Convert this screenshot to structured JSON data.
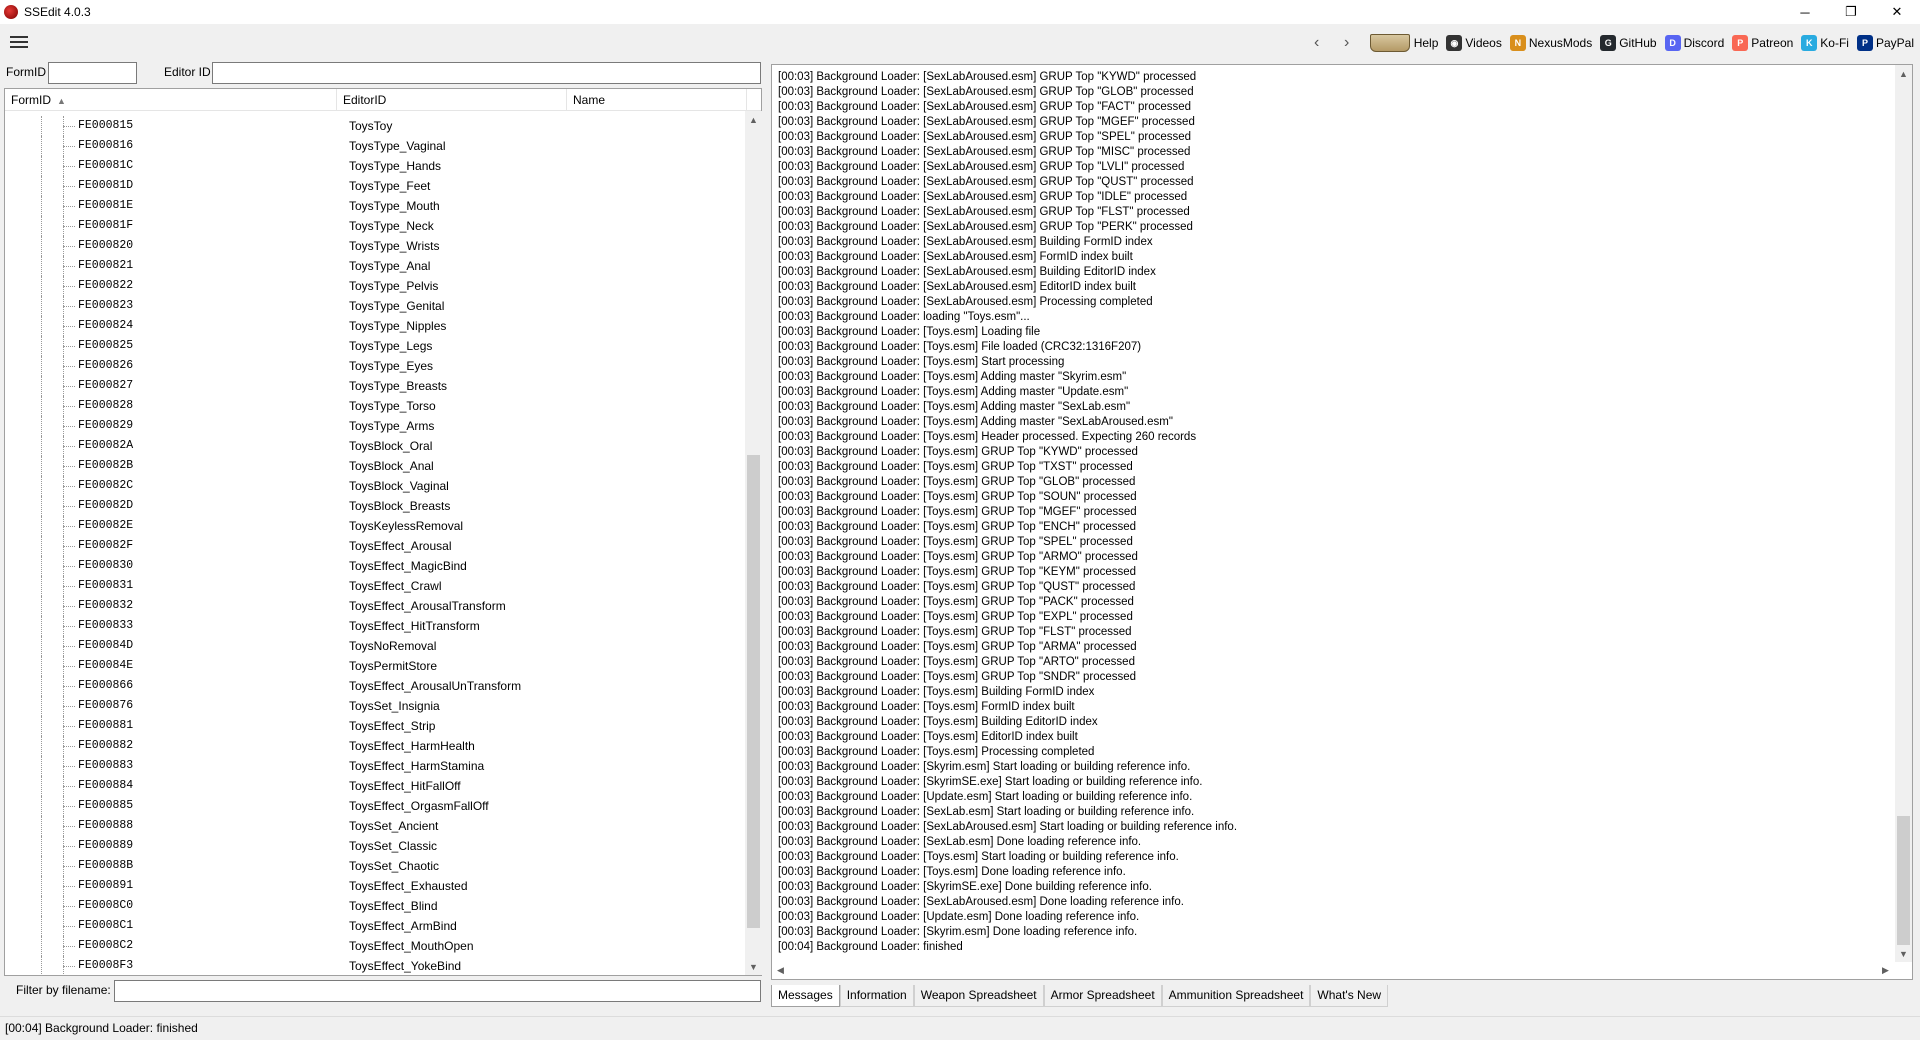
{
  "window": {
    "title": "SSEdit 4.0.3",
    "minimize": "─",
    "maximize": "❐",
    "close": "✕"
  },
  "toolbar": {
    "back": "‹",
    "forward": "›",
    "links": [
      {
        "id": "help",
        "label": "Help",
        "icon": "book-icon",
        "color": "#b49a66"
      },
      {
        "id": "videos",
        "label": "Videos",
        "icon": "videos-icon",
        "color": "#333333",
        "glyph": "◉"
      },
      {
        "id": "nexusmods",
        "label": "NexusMods",
        "icon": "nexusmods-icon",
        "color": "#d98f1c",
        "glyph": "N"
      },
      {
        "id": "github",
        "label": "GitHub",
        "icon": "github-icon",
        "color": "#24292e",
        "glyph": "G"
      },
      {
        "id": "discord",
        "label": "Discord",
        "icon": "discord-icon",
        "color": "#5865f2",
        "glyph": "D"
      },
      {
        "id": "patreon",
        "label": "Patreon",
        "icon": "patreon-icon",
        "color": "#f96854",
        "glyph": "P"
      },
      {
        "id": "kofi",
        "label": "Ko-Fi",
        "icon": "kofi-icon",
        "color": "#29abe0",
        "glyph": "K"
      },
      {
        "id": "paypal",
        "label": "PayPal",
        "icon": "paypal-icon",
        "color": "#003087",
        "glyph": "P"
      }
    ]
  },
  "filter": {
    "formid_label": "FormID",
    "formid_value": "",
    "editorid_label": "Editor ID",
    "editorid_value": ""
  },
  "tree": {
    "columns": {
      "formid": "FormID",
      "editorid": "EditorID",
      "name": "Name"
    },
    "rows": [
      {
        "formid": "FE000815",
        "editorid": "ToysToy"
      },
      {
        "formid": "FE000816",
        "editorid": "ToysType_Vaginal"
      },
      {
        "formid": "FE00081C",
        "editorid": "ToysType_Hands"
      },
      {
        "formid": "FE00081D",
        "editorid": "ToysType_Feet"
      },
      {
        "formid": "FE00081E",
        "editorid": "ToysType_Mouth"
      },
      {
        "formid": "FE00081F",
        "editorid": "ToysType_Neck"
      },
      {
        "formid": "FE000820",
        "editorid": "ToysType_Wrists"
      },
      {
        "formid": "FE000821",
        "editorid": "ToysType_Anal"
      },
      {
        "formid": "FE000822",
        "editorid": "ToysType_Pelvis"
      },
      {
        "formid": "FE000823",
        "editorid": "ToysType_Genital"
      },
      {
        "formid": "FE000824",
        "editorid": "ToysType_Nipples"
      },
      {
        "formid": "FE000825",
        "editorid": "ToysType_Legs"
      },
      {
        "formid": "FE000826",
        "editorid": "ToysType_Eyes"
      },
      {
        "formid": "FE000827",
        "editorid": "ToysType_Breasts"
      },
      {
        "formid": "FE000828",
        "editorid": "ToysType_Torso"
      },
      {
        "formid": "FE000829",
        "editorid": "ToysType_Arms"
      },
      {
        "formid": "FE00082A",
        "editorid": "ToysBlock_Oral"
      },
      {
        "formid": "FE00082B",
        "editorid": "ToysBlock_Anal"
      },
      {
        "formid": "FE00082C",
        "editorid": "ToysBlock_Vaginal"
      },
      {
        "formid": "FE00082D",
        "editorid": "ToysBlock_Breasts"
      },
      {
        "formid": "FE00082E",
        "editorid": "ToysKeylessRemoval"
      },
      {
        "formid": "FE00082F",
        "editorid": "ToysEffect_Arousal"
      },
      {
        "formid": "FE000830",
        "editorid": "ToysEffect_MagicBind"
      },
      {
        "formid": "FE000831",
        "editorid": "ToysEffect_Crawl"
      },
      {
        "formid": "FE000832",
        "editorid": "ToysEffect_ArousalTransform"
      },
      {
        "formid": "FE000833",
        "editorid": "ToysEffect_HitTransform"
      },
      {
        "formid": "FE00084D",
        "editorid": "ToysNoRemoval"
      },
      {
        "formid": "FE00084E",
        "editorid": "ToysPermitStore"
      },
      {
        "formid": "FE000866",
        "editorid": "ToysEffect_ArousalUnTransform"
      },
      {
        "formid": "FE000876",
        "editorid": "ToysSet_Insignia"
      },
      {
        "formid": "FE000881",
        "editorid": "ToysEffect_Strip"
      },
      {
        "formid": "FE000882",
        "editorid": "ToysEffect_HarmHealth"
      },
      {
        "formid": "FE000883",
        "editorid": "ToysEffect_HarmStamina"
      },
      {
        "formid": "FE000884",
        "editorid": "ToysEffect_HitFallOff"
      },
      {
        "formid": "FE000885",
        "editorid": "ToysEffect_OrgasmFallOff"
      },
      {
        "formid": "FE000888",
        "editorid": "ToysSet_Ancient"
      },
      {
        "formid": "FE000889",
        "editorid": "ToysSet_Classic"
      },
      {
        "formid": "FE00088B",
        "editorid": "ToysSet_Chaotic"
      },
      {
        "formid": "FE000891",
        "editorid": "ToysEffect_Exhausted"
      },
      {
        "formid": "FE0008C0",
        "editorid": "ToysEffect_Blind"
      },
      {
        "formid": "FE0008C1",
        "editorid": "ToysEffect_ArmBind"
      },
      {
        "formid": "FE0008C2",
        "editorid": "ToysEffect_MouthOpen"
      },
      {
        "formid": "FE0008F3",
        "editorid": "ToysEffect_YokeBind"
      }
    ]
  },
  "filename_filter": {
    "label": "Filter by filename:",
    "value": ""
  },
  "messages": [
    "[00:03] Background Loader: [SexLabAroused.esm] GRUP Top \"KYWD\" processed",
    "[00:03] Background Loader: [SexLabAroused.esm] GRUP Top \"GLOB\" processed",
    "[00:03] Background Loader: [SexLabAroused.esm] GRUP Top \"FACT\" processed",
    "[00:03] Background Loader: [SexLabAroused.esm] GRUP Top \"MGEF\" processed",
    "[00:03] Background Loader: [SexLabAroused.esm] GRUP Top \"SPEL\" processed",
    "[00:03] Background Loader: [SexLabAroused.esm] GRUP Top \"MISC\" processed",
    "[00:03] Background Loader: [SexLabAroused.esm] GRUP Top \"LVLI\" processed",
    "[00:03] Background Loader: [SexLabAroused.esm] GRUP Top \"QUST\" processed",
    "[00:03] Background Loader: [SexLabAroused.esm] GRUP Top \"IDLE\" processed",
    "[00:03] Background Loader: [SexLabAroused.esm] GRUP Top \"FLST\" processed",
    "[00:03] Background Loader: [SexLabAroused.esm] GRUP Top \"PERK\" processed",
    "[00:03] Background Loader: [SexLabAroused.esm] Building FormID index",
    "[00:03] Background Loader: [SexLabAroused.esm] FormID index built",
    "[00:03] Background Loader: [SexLabAroused.esm] Building EditorID index",
    "[00:03] Background Loader: [SexLabAroused.esm] EditorID index built",
    "[00:03] Background Loader: [SexLabAroused.esm] Processing completed",
    "[00:03] Background Loader: loading \"Toys.esm\"...",
    "[00:03] Background Loader: [Toys.esm] Loading file",
    "[00:03] Background Loader: [Toys.esm] File loaded (CRC32:1316F207)",
    "[00:03] Background Loader: [Toys.esm] Start processing",
    "[00:03] Background Loader: [Toys.esm] Adding master \"Skyrim.esm\"",
    "[00:03] Background Loader: [Toys.esm] Adding master \"Update.esm\"",
    "[00:03] Background Loader: [Toys.esm] Adding master \"SexLab.esm\"",
    "[00:03] Background Loader: [Toys.esm] Adding master \"SexLabAroused.esm\"",
    "[00:03] Background Loader: [Toys.esm] Header processed. Expecting 260 records",
    "[00:03] Background Loader: [Toys.esm] GRUP Top \"KYWD\" processed",
    "[00:03] Background Loader: [Toys.esm] GRUP Top \"TXST\" processed",
    "[00:03] Background Loader: [Toys.esm] GRUP Top \"GLOB\" processed",
    "[00:03] Background Loader: [Toys.esm] GRUP Top \"SOUN\" processed",
    "[00:03] Background Loader: [Toys.esm] GRUP Top \"MGEF\" processed",
    "[00:03] Background Loader: [Toys.esm] GRUP Top \"ENCH\" processed",
    "[00:03] Background Loader: [Toys.esm] GRUP Top \"SPEL\" processed",
    "[00:03] Background Loader: [Toys.esm] GRUP Top \"ARMO\" processed",
    "[00:03] Background Loader: [Toys.esm] GRUP Top \"KEYM\" processed",
    "[00:03] Background Loader: [Toys.esm] GRUP Top \"QUST\" processed",
    "[00:03] Background Loader: [Toys.esm] GRUP Top \"PACK\" processed",
    "[00:03] Background Loader: [Toys.esm] GRUP Top \"EXPL\" processed",
    "[00:03] Background Loader: [Toys.esm] GRUP Top \"FLST\" processed",
    "[00:03] Background Loader: [Toys.esm] GRUP Top \"ARMA\" processed",
    "[00:03] Background Loader: [Toys.esm] GRUP Top \"ARTO\" processed",
    "[00:03] Background Loader: [Toys.esm] GRUP Top \"SNDR\" processed",
    "[00:03] Background Loader: [Toys.esm] Building FormID index",
    "[00:03] Background Loader: [Toys.esm] FormID index built",
    "[00:03] Background Loader: [Toys.esm] Building EditorID index",
    "[00:03] Background Loader: [Toys.esm] EditorID index built",
    "[00:03] Background Loader: [Toys.esm] Processing completed",
    "[00:03] Background Loader: [Skyrim.esm] Start loading or building reference info.",
    "[00:03] Background Loader: [SkyrimSE.exe] Start loading or building reference info.",
    "[00:03] Background Loader: [Update.esm] Start loading or building reference info.",
    "[00:03] Background Loader: [SexLab.esm] Start loading or building reference info.",
    "[00:03] Background Loader: [SexLabAroused.esm] Start loading or building reference info.",
    "[00:03] Background Loader: [SexLab.esm] Done loading reference info.",
    "[00:03] Background Loader: [Toys.esm] Start loading or building reference info.",
    "[00:03] Background Loader: [Toys.esm] Done loading reference info.",
    "[00:03] Background Loader: [SkyrimSE.exe] Done building reference info.",
    "[00:03] Background Loader: [SexLabAroused.esm] Done loading reference info.",
    "[00:03] Background Loader: [Update.esm] Done loading reference info.",
    "[00:03] Background Loader: [Skyrim.esm] Done loading reference info.",
    "[00:04] Background Loader: finished"
  ],
  "tabs": [
    "Messages",
    "Information",
    "Weapon Spreadsheet",
    "Armor Spreadsheet",
    "Ammunition Spreadsheet",
    "What's New"
  ],
  "active_tab": "Messages",
  "status": "[00:04] Background Loader: finished",
  "scroll": {
    "tree_thumb_fraction": 0.57,
    "messages_thumb_fraction": 0.15
  }
}
